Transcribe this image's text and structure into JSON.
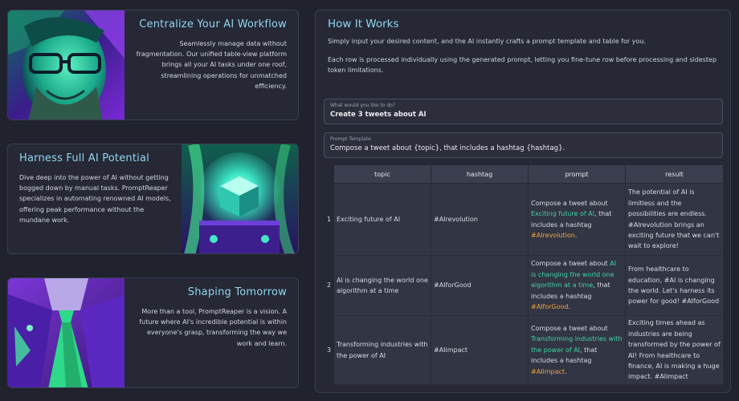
{
  "cards": [
    {
      "title": "Centralize Your AI Workflow",
      "text": "Seamlessly manage data without fragmentation. Our unified table-view platform brings all your AI tasks under one roof, streamlining operations for unmatched efficiency."
    },
    {
      "title": "Harness Full AI Potential",
      "text": "Dive deep into the power of AI without getting bogged down by manual tasks. PromptReaper specializes in automating renowned AI models, offering peak performance without the mundane work."
    },
    {
      "title": "Shaping Tomorrow",
      "text": "More than a tool, PromptReaper is a vision. A future where AI's incredible potential is within everyone's grasp, transforming the way we work and learn."
    }
  ],
  "how": {
    "title": "How It Works",
    "p1": "Simply input your desired content, and the AI instantly crafts a prompt template and table for you.",
    "p2": "Each row is processed individually using the generated prompt, letting you fine-tune row before processing and sidestep token limitations."
  },
  "input": {
    "label": "What would you like to do?",
    "value": "Create 3 tweets about AI"
  },
  "template": {
    "label": "Prompt Template",
    "value": "Compose a tweet about {topic}, that includes a hashtag {hashtag}."
  },
  "table": {
    "headers": [
      "topic",
      "hashtag",
      "prompt",
      "result"
    ],
    "rows": [
      {
        "idx": "1",
        "topic": "Exciting future of AI",
        "hashtag": "#AIrevolution",
        "prompt_pre": "Compose a tweet about ",
        "prompt_topic": "Exciting future of AI",
        "prompt_mid": ", that includes a hashtag ",
        "prompt_tag": "#AIrevolution",
        "prompt_end": ".",
        "result": "The potential of AI is limitless and the possibilities are endless. #AIrevolution brings an exciting future that we can't wait to explore!"
      },
      {
        "idx": "2",
        "topic": "AI is changing the world one algorithm at a time",
        "hashtag": "#AIforGood",
        "prompt_pre": "Compose a tweet about ",
        "prompt_topic": "AI is changing the world one algorithm at a time",
        "prompt_mid": ", that includes a hashtag ",
        "prompt_tag": "#AIforGood",
        "prompt_end": ".",
        "result": "From healthcare to education, #AI is changing the world. Let's harness its power for good! #AIforGood"
      },
      {
        "idx": "3",
        "topic": "Transforming industries with the power of AI",
        "hashtag": "#AIimpact",
        "prompt_pre": "Compose a tweet about ",
        "prompt_topic": "Transforming industries with the power of AI",
        "prompt_mid": ", that includes a hashtag ",
        "prompt_tag": "#AIimpact",
        "prompt_end": ".",
        "result": "Exciting times ahead as industries are being transformed by the power of AI! From healthcare to finance, AI is making a huge impact. #AIimpact"
      }
    ]
  },
  "colors": {
    "accent": "#8fd6ee",
    "topic_highlight": "#3fd3a4",
    "hashtag_highlight": "#f2a33a",
    "background": "#20222e"
  }
}
